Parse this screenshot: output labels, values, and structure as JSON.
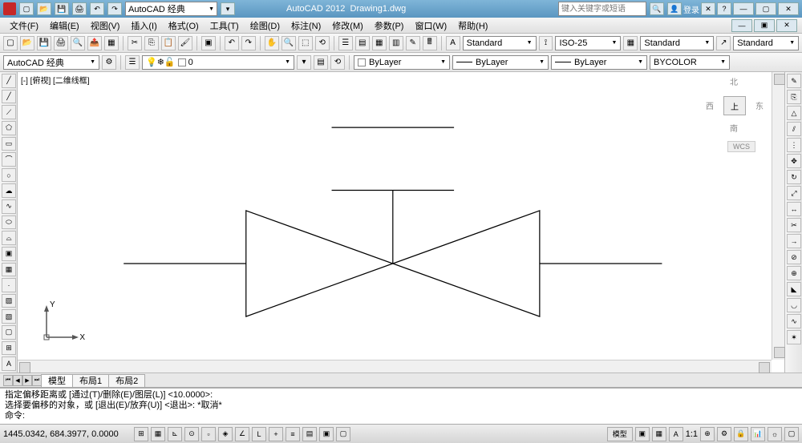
{
  "title": {
    "app": "AutoCAD 2012",
    "doc": "Drawing1.dwg"
  },
  "workspace_dd": "AutoCAD 经典",
  "search_placeholder": "键入关键字或短语",
  "login": "登录",
  "menu": [
    "文件(F)",
    "编辑(E)",
    "视图(V)",
    "插入(I)",
    "格式(O)",
    "工具(T)",
    "绘图(D)",
    "标注(N)",
    "修改(M)",
    "参数(P)",
    "窗口(W)",
    "帮助(H)"
  ],
  "styles": {
    "text": "Standard",
    "dim": "ISO-25",
    "table": "Standard",
    "ml": "Standard"
  },
  "workspace_dd2": "AutoCAD 经典",
  "layer_current": "0",
  "props": {
    "color": "ByLayer",
    "ltype": "ByLayer",
    "lweight": "ByLayer",
    "plot": "BYCOLOR"
  },
  "canvas_label": "[-] [俯视] [二维线框]",
  "viewcube": {
    "n": "北",
    "s": "南",
    "e": "东",
    "w": "西",
    "top": "上",
    "wcs": "WCS"
  },
  "tabs": [
    "模型",
    "布局1",
    "布局2"
  ],
  "cmd": {
    "l1": "指定偏移距离或 [通过(T)/删除(E)/图层(L)] <10.0000>:",
    "l2": "选择要偏移的对象，或 [退出(E)/放弃(U)] <退出>:  *取消*",
    "prompt": "命令:"
  },
  "status": {
    "coords": "1445.0342, 684.3977, 0.0000",
    "ms": "模型",
    "scale": "1:1"
  },
  "ucs_axes": {
    "x": "X",
    "y": "Y"
  }
}
